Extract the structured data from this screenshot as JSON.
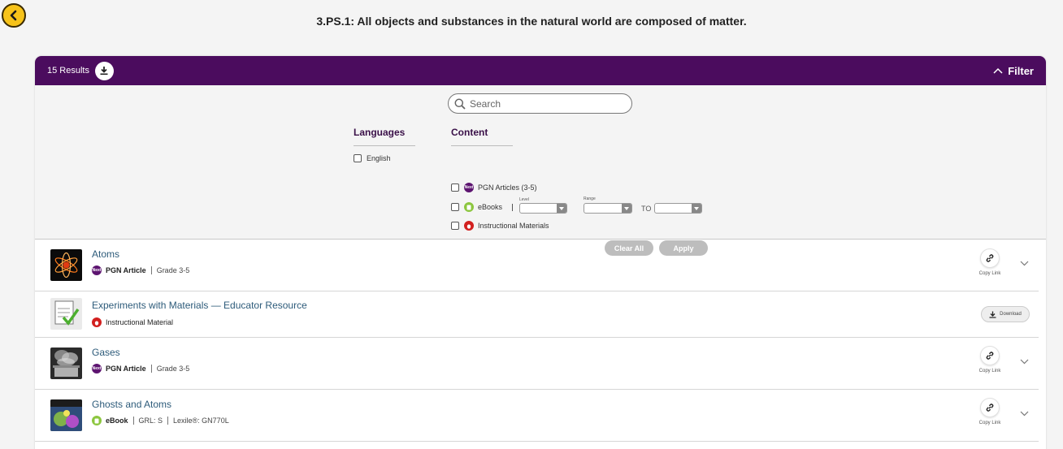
{
  "page": {
    "title": "3.PS.1: All objects and substances in the natural world are composed of matter."
  },
  "header": {
    "results_label": "15 Results",
    "filter_label": "Filter",
    "accent_color": "#4b0c5e"
  },
  "filters": {
    "search_placeholder": "Search",
    "languages_heading": "Languages",
    "languages": [
      {
        "label": "English",
        "checked": false
      }
    ],
    "content_heading": "Content",
    "content_options": [
      {
        "label": "PGN Articles (3-5)",
        "icon": "next-badge-icon",
        "checked": false
      },
      {
        "label": "eBooks",
        "icon": "ebook-badge-icon",
        "checked": false
      },
      {
        "label": "Instructional Materials",
        "icon": "instructional-badge-icon",
        "checked": false
      }
    ],
    "level_label": "Level",
    "range_label": "Range",
    "to_label": "TO",
    "clear_label": "Clear All",
    "apply_label": "Apply"
  },
  "results": [
    {
      "title": "Atoms",
      "type": "PGN Article",
      "badge": "Next",
      "details": [
        "Grade 3-5"
      ],
      "action": "Copy Link",
      "thumbnail": "atom-thumbnail"
    },
    {
      "title": "Experiments with Materials — Educator Resource",
      "type": "Instructional Material",
      "badge": "",
      "details": [],
      "action": "Download",
      "thumbnail": "document-check-thumbnail"
    },
    {
      "title": "Gases",
      "type": "PGN Article",
      "badge": "Next",
      "details": [
        "Grade 3-5"
      ],
      "action": "Copy Link",
      "thumbnail": "steaming-pot-thumbnail"
    },
    {
      "title": "Ghosts and Atoms",
      "type": "eBook",
      "badge": "",
      "details": [
        "GRL: S",
        "Lexile®: GN770L"
      ],
      "action": "Copy Link",
      "thumbnail": "book-cover-thumbnail"
    }
  ]
}
